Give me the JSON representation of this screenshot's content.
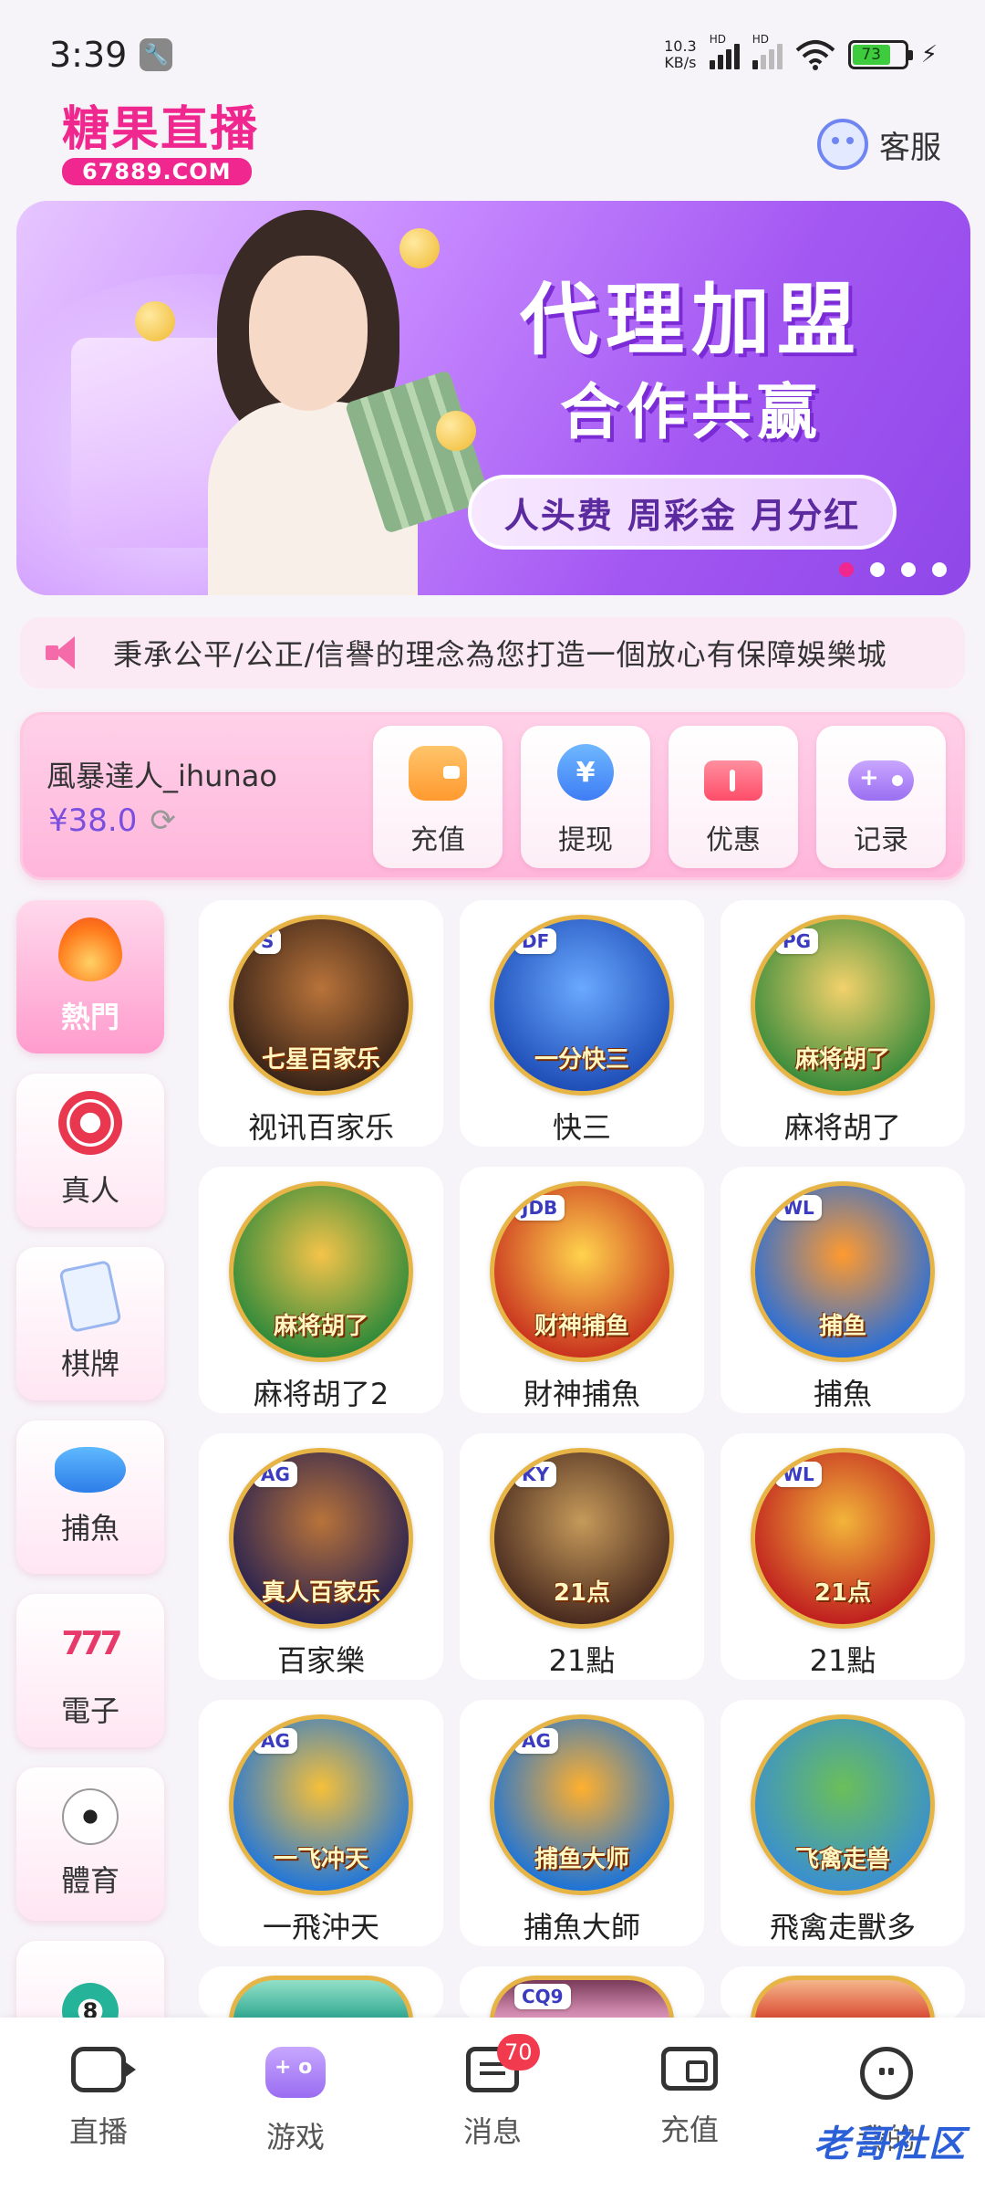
{
  "status_bar": {
    "time": "3:39",
    "net_speed_value": "10.3",
    "net_speed_unit": "KB/s",
    "hd_label": "HD",
    "battery_percent": "73"
  },
  "header": {
    "logo_text": "糖果直播",
    "logo_domain": "67889.COM",
    "service_label": "客服"
  },
  "banner": {
    "title": "代理加盟",
    "subtitle": "合作共赢",
    "pill_text": "人头费 周彩金 月分红",
    "slide_count": 4,
    "active_slide": 1
  },
  "marquee": {
    "text": "秉承公平/公正/信譽的理念為您打造一個放心有保障娛樂城"
  },
  "user_card": {
    "username": "風暴達人_ihunao",
    "balance": "¥38.0",
    "actions": [
      {
        "label": "充值",
        "icon": "wallet-icon"
      },
      {
        "label": "提现",
        "icon": "yen-icon"
      },
      {
        "label": "优惠",
        "icon": "ticket-icon"
      },
      {
        "label": "记录",
        "icon": "gamepad-icon"
      }
    ]
  },
  "categories": [
    {
      "label": "熱門",
      "icon": "flame-icon",
      "active": true
    },
    {
      "label": "真人",
      "icon": "casino-chip-icon"
    },
    {
      "label": "棋牌",
      "icon": "playing-card-icon"
    },
    {
      "label": "捕魚",
      "icon": "fish-icon"
    },
    {
      "label": "電子",
      "icon": "slot-777-icon"
    },
    {
      "label": "體育",
      "icon": "soccer-ball-icon"
    },
    {
      "label": "",
      "icon": "lottery-ball-icon",
      "ball_number": "8"
    }
  ],
  "games": [
    {
      "name": "视讯百家乐",
      "thumb_caption": "七星百家乐",
      "provider": "S",
      "colors": [
        "#3a2418",
        "#b8733a"
      ]
    },
    {
      "name": "快三",
      "thumb_caption": "一分快三",
      "provider": "DF",
      "colors": [
        "#1f4fb8",
        "#6aa9ff"
      ]
    },
    {
      "name": "麻将胡了",
      "thumb_caption": "麻将胡了",
      "provider": "PG",
      "colors": [
        "#3c8c3c",
        "#f2d16b"
      ]
    },
    {
      "name": "麻将胡了2",
      "thumb_caption": "麻将胡了",
      "provider": "",
      "colors": [
        "#2f8a3a",
        "#f4c34a"
      ]
    },
    {
      "name": "財神捕魚",
      "thumb_caption": "财神捕鱼",
      "provider": "JDB",
      "colors": [
        "#c9341f",
        "#ffd34d"
      ]
    },
    {
      "name": "捕魚",
      "thumb_caption": "捕鱼",
      "provider": "WL",
      "colors": [
        "#2a6fd8",
        "#ff9a2f"
      ]
    },
    {
      "name": "百家樂",
      "thumb_caption": "真人百家乐",
      "provider": "AG",
      "colors": [
        "#2b2350",
        "#b8733a"
      ]
    },
    {
      "name": "21點",
      "thumb_caption": "21点",
      "provider": "KY",
      "colors": [
        "#4a2b1f",
        "#c69a5a"
      ]
    },
    {
      "name": "21點",
      "thumb_caption": "21点",
      "provider": "WL",
      "colors": [
        "#c0201f",
        "#f2b53a"
      ]
    },
    {
      "name": "一飛沖天",
      "thumb_caption": "一飞冲天",
      "provider": "AG",
      "colors": [
        "#2377d8",
        "#f5c03a"
      ]
    },
    {
      "name": "捕魚大師",
      "thumb_caption": "捕鱼大师",
      "provider": "AG",
      "colors": [
        "#1e74d6",
        "#ffb02e"
      ]
    },
    {
      "name": "飛禽走獸多",
      "thumb_caption": "飞禽走兽",
      "provider": "",
      "colors": [
        "#3a8fd0",
        "#6bbf59"
      ]
    }
  ],
  "partial_games": [
    {
      "provider": "",
      "colors": [
        "#2ba58f",
        "#93e0c8"
      ]
    },
    {
      "provider": "CQ9",
      "colors": [
        "#e9a0c7",
        "#7a3b5a"
      ]
    },
    {
      "provider": "",
      "colors": [
        "#d9452f",
        "#f5b58a"
      ]
    }
  ],
  "bottom_nav": [
    {
      "label": "直播",
      "icon": "camera-icon"
    },
    {
      "label": "游戏",
      "icon": "gamepad-icon",
      "active": true
    },
    {
      "label": "消息",
      "icon": "message-icon",
      "badge": "70"
    },
    {
      "label": "充值",
      "icon": "wallet-icon"
    },
    {
      "label": "我的",
      "icon": "face-icon"
    }
  ],
  "watermark": "老哥社区",
  "colors": {
    "brand_pink": "#f0278e",
    "balance_purple": "#7a4fe0",
    "badge_red": "#f23a4e"
  }
}
